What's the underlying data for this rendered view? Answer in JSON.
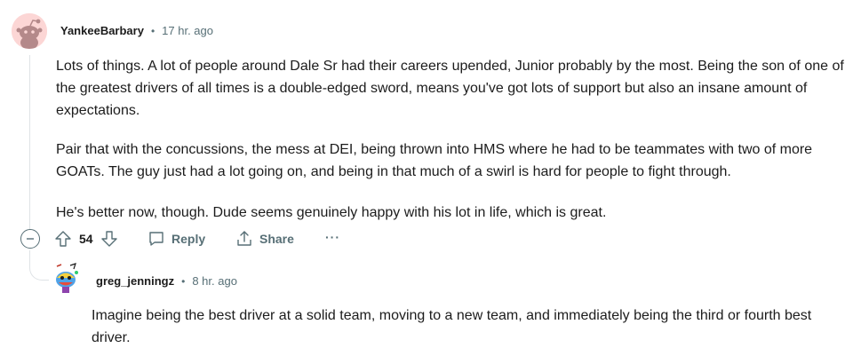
{
  "comment": {
    "username": "YankeeBarbary",
    "separator": "•",
    "time": "17 hr. ago",
    "paragraphs": [
      "Lots of things. A lot of people around Dale Sr had their careers upended, Junior probably by the most. Being the son of one of the greatest drivers of all times is a double-edged sword, means you've got lots of support but also an insane amount of expectations.",
      "Pair that with the concussions, the mess at DEI, being thrown into HMS where he had to be teammates with two of more GOATs. The guy just had a lot going on, and being in that much of a swirl is hard for people to fight through.",
      "He's better now, though. Dude seems genuinely happy with his lot in life, which is great."
    ],
    "actions": {
      "collapse_icon": "minus-circle-icon",
      "upvote_icon": "upvote-arrow-icon",
      "score": "54",
      "downvote_icon": "downvote-arrow-icon",
      "reply_label": "Reply",
      "share_label": "Share",
      "more_label": "···"
    }
  },
  "reply": {
    "username": "greg_jenningz",
    "separator": "•",
    "time": "8 hr. ago",
    "text": "Imagine being the best driver at a solid team, moving to a new team, and immediately being the third or fourth best driver."
  },
  "colors": {
    "meta_gray": "#576f76",
    "text": "#1c1c1c",
    "thread_line": "#dfe3e6",
    "avatar_bg": "#fcd6d5"
  }
}
